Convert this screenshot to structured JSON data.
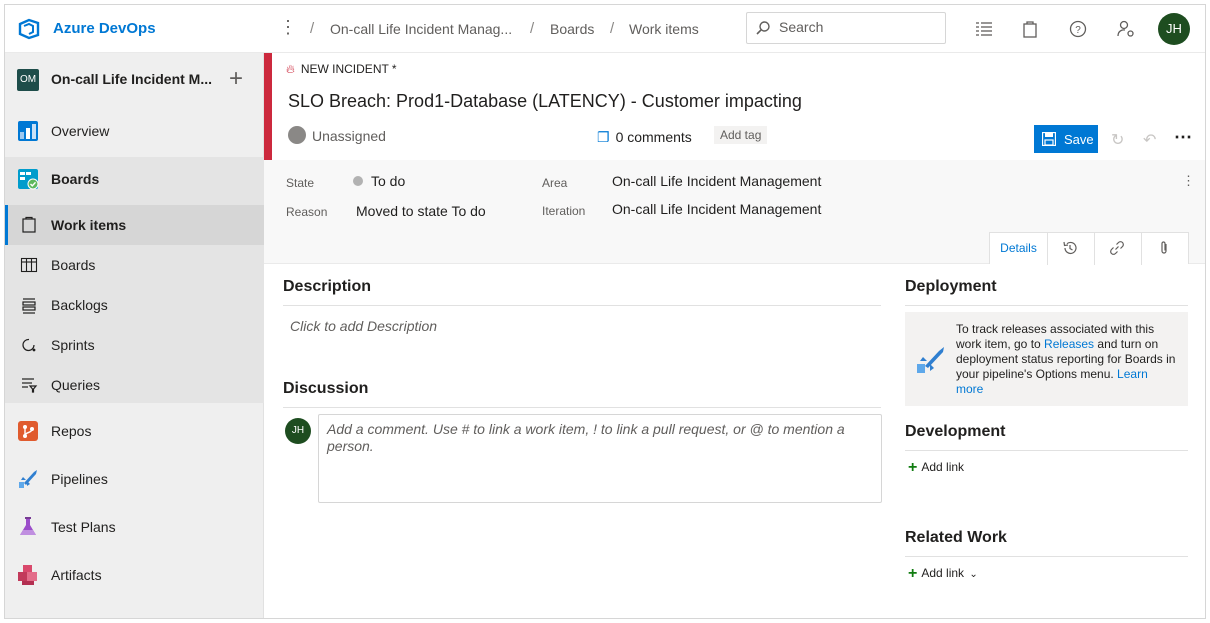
{
  "topbar": {
    "brand": "Azure DevOps",
    "breadcrumbs": [
      "On-call Life Incident Manag...",
      "Boards",
      "Work items"
    ],
    "search_placeholder": "Search",
    "user_initials": "JH",
    "icons": [
      "list-icon",
      "bag-icon",
      "help-icon",
      "user-settings-icon"
    ]
  },
  "sidebar": {
    "project_badge": "OM",
    "project_name": "On-call Life Incident M...",
    "items": [
      {
        "label": "Overview",
        "icon": "overview-icon"
      },
      {
        "label": "Boards",
        "icon": "boards-icon"
      },
      {
        "label": "Repos",
        "icon": "repos-icon"
      },
      {
        "label": "Pipelines",
        "icon": "pipelines-icon"
      },
      {
        "label": "Test Plans",
        "icon": "test-plans-icon"
      },
      {
        "label": "Artifacts",
        "icon": "artifacts-icon"
      }
    ],
    "sub_items": [
      {
        "label": "Work items",
        "icon": "work-items-icon"
      },
      {
        "label": "Boards",
        "icon": "board-icon"
      },
      {
        "label": "Backlogs",
        "icon": "backlogs-icon"
      },
      {
        "label": "Sprints",
        "icon": "sprints-icon"
      },
      {
        "label": "Queries",
        "icon": "queries-icon"
      }
    ]
  },
  "work_item": {
    "type": "NEW INCIDENT *",
    "title": "SLO Breach: Prod1-Database (LATENCY) - Customer impacting",
    "assignee": "Unassigned",
    "comments": "0 comments",
    "add_tag": "Add tag",
    "save_label": "Save"
  },
  "fields": {
    "state_label": "State",
    "state_value": "To do",
    "reason_label": "Reason",
    "reason_value": "Moved to state To do",
    "area_label": "Area",
    "area_value": "On-call Life Incident Management",
    "iteration_label": "Iteration",
    "iteration_value": "On-call Life Incident Management"
  },
  "tabs": {
    "details": "Details"
  },
  "description": {
    "title": "Description",
    "placeholder": "Click to add Description"
  },
  "discussion": {
    "title": "Discussion",
    "avatar": "JH",
    "placeholder": "Add a comment. Use # to link a work item, ! to link a pull request, or @ to mention a person."
  },
  "deployment": {
    "title": "Deployment",
    "text_1": "To track releases associated with this work item, go to ",
    "link_releases": "Releases",
    "text_2": " and turn on deployment status reporting for Boards in your pipeline's Options menu. ",
    "link_learn": "Learn more"
  },
  "development": {
    "title": "Development",
    "add_link": "Add link"
  },
  "related_work": {
    "title": "Related Work",
    "add_link": "Add link"
  },
  "colors": {
    "accent": "#0078d4",
    "incident_red": "#cc293d",
    "avatar_green": "#1e4d20"
  }
}
